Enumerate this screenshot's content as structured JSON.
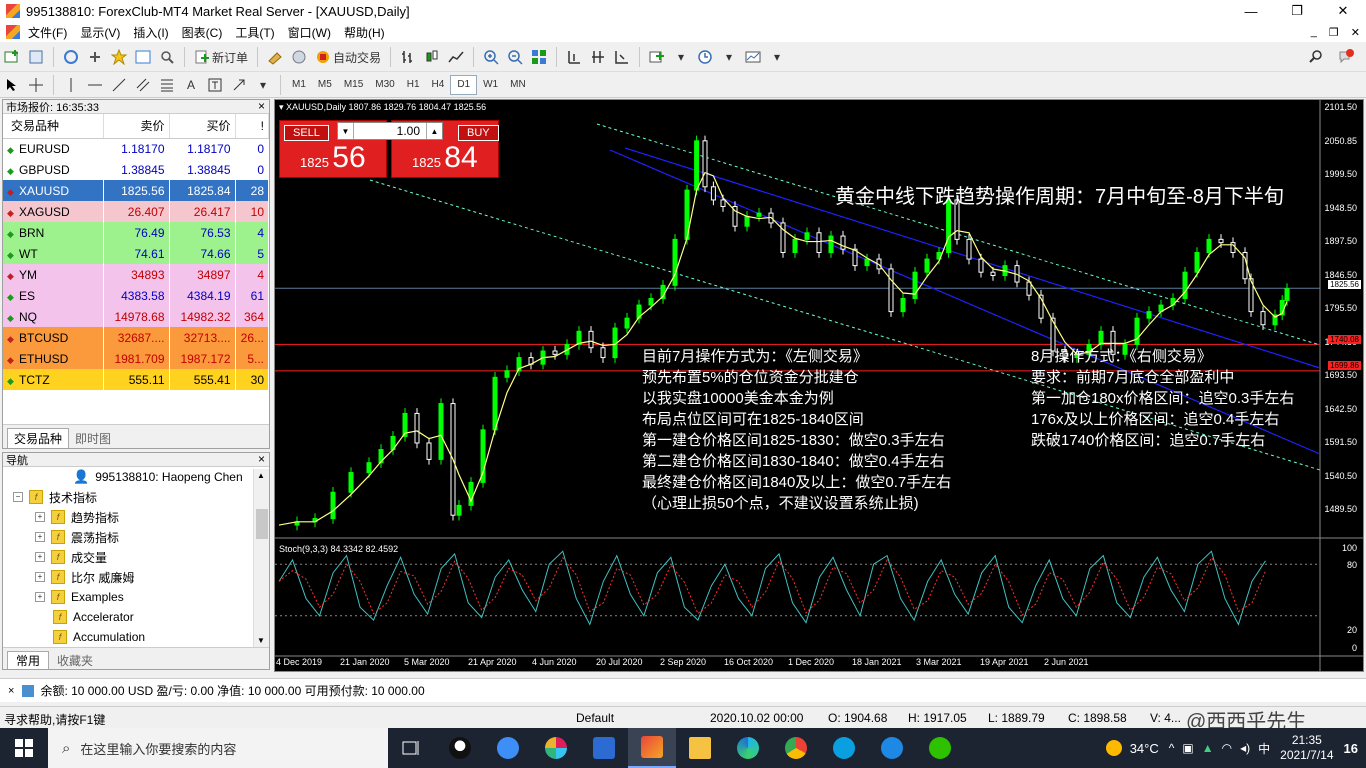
{
  "window": {
    "title": "995138810: ForexClub-MT4 Market Real Server - [XAUUSD,Daily]",
    "min": "—",
    "restore": "❐",
    "close": "✕"
  },
  "menu": [
    "文件(F)",
    "显示(V)",
    "插入(I)",
    "图表(C)",
    "工具(T)",
    "窗口(W)",
    "帮助(H)"
  ],
  "toolbar": {
    "new_order": "新订单",
    "auto_trade": "自动交易",
    "timeframes": [
      "M1",
      "M5",
      "M15",
      "M30",
      "H1",
      "H4",
      "D1",
      "W1",
      "MN"
    ],
    "active_timeframe": "D1"
  },
  "market_watch": {
    "header": "市场报价: 16:35:33",
    "columns": [
      "交易品种",
      "卖价",
      "买价",
      "!"
    ],
    "rows": [
      {
        "symbol": "EURUSD",
        "bid": "1.18170",
        "ask": "1.18170",
        "spread": "0",
        "bg": "#ffffff",
        "color": "#0000c0",
        "dir": "up"
      },
      {
        "symbol": "GBPUSD",
        "bid": "1.38845",
        "ask": "1.38845",
        "spread": "0",
        "bg": "#ffffff",
        "color": "#0000c0",
        "dir": "up"
      },
      {
        "symbol": "XAUUSD",
        "bid": "1825.56",
        "ask": "1825.84",
        "spread": "28",
        "bg": "#3373c4",
        "color": "#ffffff",
        "dir": "down"
      },
      {
        "symbol": "XAGUSD",
        "bid": "26.407",
        "ask": "26.417",
        "spread": "10",
        "bg": "#f6c6cf",
        "color": "#c00000",
        "dir": "down"
      },
      {
        "symbol": "BRN",
        "bid": "76.49",
        "ask": "76.53",
        "spread": "4",
        "bg": "#9ef28e",
        "color": "#0000c0",
        "dir": "up"
      },
      {
        "symbol": "WT",
        "bid": "74.61",
        "ask": "74.66",
        "spread": "5",
        "bg": "#9ef28e",
        "color": "#0000c0",
        "dir": "up"
      },
      {
        "symbol": "YM",
        "bid": "34893",
        "ask": "34897",
        "spread": "4",
        "bg": "#f3c3ec",
        "color": "#c00000",
        "dir": "down"
      },
      {
        "symbol": "ES",
        "bid": "4383.58",
        "ask": "4384.19",
        "spread": "61",
        "bg": "#f3c3ec",
        "color": "#0000c0",
        "dir": "up"
      },
      {
        "symbol": "NQ",
        "bid": "14978.68",
        "ask": "14982.32",
        "spread": "364",
        "bg": "#f3c3ec",
        "color": "#c00000",
        "dir": "up"
      },
      {
        "symbol": "BTCUSD",
        "bid": "32687....",
        "ask": "32713....",
        "spread": "26...",
        "bg": "#fb9a3c",
        "color": "#c00000",
        "dir": "down"
      },
      {
        "symbol": "ETHUSD",
        "bid": "1981.709",
        "ask": "1987.172",
        "spread": "5...",
        "bg": "#fb9a3c",
        "color": "#c00000",
        "dir": "down"
      },
      {
        "symbol": "TCTZ",
        "bid": "555.11",
        "ask": "555.41",
        "spread": "30",
        "bg": "#ffd21f",
        "color": "#000000",
        "dir": "up"
      }
    ],
    "tabs": [
      "交易品种",
      "即时图"
    ]
  },
  "navigator": {
    "header": "导航",
    "account": "995138810: Haopeng Chen",
    "indicators_root": "技术指标",
    "items": [
      "趋势指标",
      "震荡指标",
      "成交量",
      "比尔 威廉姆",
      "Examples",
      "Accelerator",
      "Accumulation"
    ],
    "tabs": [
      "常用",
      "收藏夹"
    ]
  },
  "chart": {
    "info": "XAUUSD,Daily  1807.86 1829.76 1804.47 1825.56",
    "sell_label": "SELL",
    "buy_label": "BUY",
    "volume": "1.00",
    "sell_price_small": "1825",
    "sell_price_big": "56",
    "buy_price_small": "1825",
    "buy_price_big": "84",
    "title_annotation": "黄金中线下跌趋势操作周期：7月中旬至-8月下半旬",
    "left_annotation": [
      "目前7月操作方式为：《左侧交易》",
      "预先布置5%的仓位资金分批建仓",
      "以我实盘10000美金本金为例",
      "布局点位区间可在1825-1840区间",
      "第一建仓价格区间1825-1830：做空0.3手左右",
      "第二建仓价格区间1830-1840：做空0.4手左右",
      "最终建仓价格区间1840及以上：做空0.7手左右",
      "（心理止损50个点，不建议设置系统止损)"
    ],
    "right_annotation": [
      "8月操作方式：《右侧交易》",
      "要求：前期7月底仓全部盈利中",
      "第一加仓180x价格区间：追空0.3手左右",
      "176x及以上价格区间：追空0.4手左右",
      "跌破1740价格区间：追空0.7手左右"
    ],
    "price_labels": [
      "2101.50",
      "2050.85",
      "1999.50",
      "1948.50",
      "1897.50",
      "1846.50",
      "1795.50",
      "1744.50",
      "1693.50",
      "1642.50",
      "1591.50",
      "1540.50",
      "1489.50"
    ],
    "current_price_tag": "1825.56",
    "red_tag_1": "1740.08",
    "red_tag_2": "1699.86",
    "date_labels": [
      "4 Dec 2019",
      "21 Jan 2020",
      "5 Mar 2020",
      "21 Apr 2020",
      "4 Jun 2020",
      "20 Jul 2020",
      "2 Sep 2020",
      "16 Oct 2020",
      "1 Dec 2020",
      "18 Jan 2021",
      "3 Mar 2021",
      "19 Apr 2021",
      "2 Jun 2021"
    ],
    "stoch_label": "Stoch(9,3,3) 84.3342 82.4592",
    "stoch_levels": [
      "100",
      "80",
      "20",
      "0"
    ],
    "colors": {
      "candle_up": "#00ff00",
      "candle_down": "#ffffff",
      "channel": "#2020ff",
      "dashed": "#66ffcc",
      "hline_red": "#ff2020",
      "ma": "#ffff88",
      "stoch_main": "#40c0c0",
      "stoch_signal": "#ff3030"
    }
  },
  "terminal": {
    "text": "余额: 10 000.00 USD  盈/亏: 0.00  净值: 10 000.00  可用预付款: 10 000.00"
  },
  "status": {
    "help": "寻求帮助,请按F1键",
    "profile": "Default",
    "datetime": "2020.10.02 00:00",
    "open": "O: 1904.68",
    "high": "H: 1917.05",
    "low": "L: 1889.79",
    "close": "C: 1898.58",
    "volume": "V: 4...",
    "watermark": "@西西乎先生"
  },
  "taskbar": {
    "search_placeholder": "在这里输入你要搜索的内容",
    "temp": "34°C",
    "ime": "中",
    "time": "21:35",
    "date": "2021/7/14",
    "notif": "16"
  }
}
